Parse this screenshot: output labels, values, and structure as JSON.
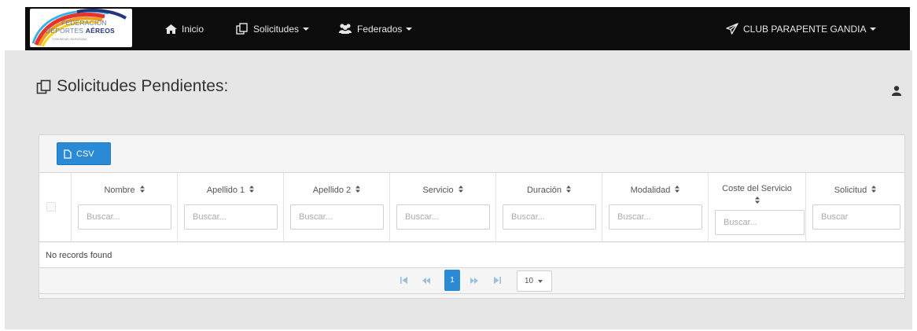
{
  "brand": {
    "line1": "FEDERACIÓN",
    "line2_a": "DEPORTES ",
    "line2_b": "AÉREOS",
    "line3": "COMUNIDAD VALENCIANA",
    "colors": {
      "blue": "#24377a",
      "red": "#e3342f",
      "orange": "#f29a1d",
      "yellow": "#f4d21d",
      "cyan": "#39b3e6"
    }
  },
  "nav": {
    "home_label": "Inicio",
    "home_icon": "home-icon",
    "solicitudes_label": "Solicitudes",
    "solicitudes_icon": "files-icon",
    "federados_label": "Federados",
    "federados_icon": "users-icon",
    "club_label": "CLUB PARAPENTE GANDIA",
    "club_icon": "paper-plane-icon"
  },
  "user_icon": "user-icon",
  "page": {
    "title": "Solicitudes Pendientes:",
    "title_icon": "files-icon"
  },
  "toolbar": {
    "csv_label": "CSV",
    "csv_icon": "file-icon"
  },
  "table": {
    "columns": [
      {
        "label": "Nombre",
        "placeholder": "Buscar..."
      },
      {
        "label": "Apellido 1",
        "placeholder": "Buscar..."
      },
      {
        "label": "Apellido 2",
        "placeholder": "Buscar..."
      },
      {
        "label": "Servicio",
        "placeholder": "Buscar..."
      },
      {
        "label": "Duración",
        "placeholder": "Buscar..."
      },
      {
        "label": "Modalidad",
        "placeholder": "Buscar..."
      },
      {
        "label": "Coste del Servicio",
        "placeholder": "Buscar..."
      },
      {
        "label": "Solicitud",
        "placeholder": "Buscar"
      }
    ],
    "empty_message": "No records found"
  },
  "pagination": {
    "first_label": "⏮",
    "prev_label": "⏪",
    "current_page": "1",
    "next_label": "⏩",
    "last_label": "⏭",
    "per_page": "10"
  },
  "colors": {
    "accent": "#2a8ad6",
    "navbar": "#0c0c0c",
    "background": "#e6e6e6"
  }
}
